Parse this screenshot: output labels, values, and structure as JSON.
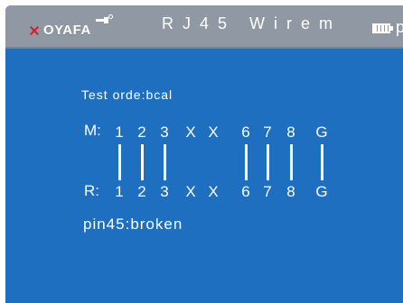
{
  "header": {
    "brand": "OYAFA",
    "title": "RJ45 Wirem",
    "title_cut": "p"
  },
  "icons": {
    "brand_mark": "brand-mark-icon",
    "cable": "cable-icon",
    "battery": "battery-icon"
  },
  "test_line": "Test orde:bcal",
  "rows": {
    "m_label": "M:",
    "r_label": "R:",
    "m": [
      "1",
      "2",
      "3",
      "X",
      "X",
      "6",
      "7",
      "8",
      "G"
    ],
    "r": [
      "1",
      "2",
      "3",
      "X",
      "X",
      "6",
      "7",
      "8",
      "G"
    ]
  },
  "status": "pin45:broken",
  "colors": {
    "screen": "#1f6fc0",
    "header": "#8f98a3",
    "brand_red": "#d61f2c",
    "text": "#ffffff"
  }
}
